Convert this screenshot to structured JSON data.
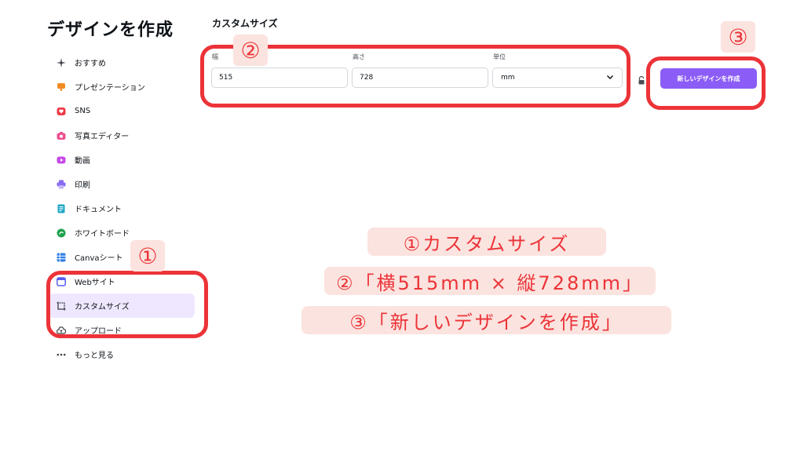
{
  "page_title": "デザインを作成",
  "sidebar": {
    "items": [
      {
        "label": "おすすめ",
        "icon": "sparkle-icon",
        "color": "#3b3f46"
      },
      {
        "label": "プレゼンテーション",
        "icon": "presentation-icon",
        "color": "#f38b23"
      },
      {
        "label": "SNS",
        "icon": "heart-icon",
        "color": "#ef3a48"
      },
      {
        "label": "写真エディター",
        "icon": "camera-icon",
        "color": "#ec4f8f"
      },
      {
        "label": "動画",
        "icon": "video-icon",
        "color": "#c849e8"
      },
      {
        "label": "印刷",
        "icon": "printer-icon",
        "color": "#8a6bf2"
      },
      {
        "label": "ドキュメント",
        "icon": "document-icon",
        "color": "#1ea6c7"
      },
      {
        "label": "ホワイトボード",
        "icon": "whiteboard-icon",
        "color": "#1fa14d"
      },
      {
        "label": "Canvaシート",
        "icon": "spreadsheet-icon",
        "color": "#2f7ee6"
      },
      {
        "label": "Webサイト",
        "icon": "website-icon",
        "color": "#5a5ff0"
      },
      {
        "label": "カスタムサイズ",
        "icon": "custom-size-icon",
        "color": "#3b3f46",
        "active": true
      },
      {
        "label": "アップロード",
        "icon": "upload-cloud-icon",
        "color": "#3b3f46"
      },
      {
        "label": "もっと見る",
        "icon": "more-dots-icon",
        "color": "#3b3f46"
      }
    ]
  },
  "custom_size": {
    "title": "カスタムサイズ",
    "width_label": "幅",
    "width_value": "515",
    "height_label": "高さ",
    "height_value": "728",
    "unit_label": "単位",
    "unit_value": "mm",
    "create_button": "新しいデザインを作成"
  },
  "annotations": {
    "badge_1": "①",
    "badge_2": "②",
    "badge_3": "③",
    "note_lines": [
      "①カスタムサイズ",
      "②「横515mm × 縦728mm」",
      "③「新しいデザインを作成」"
    ],
    "accent_color": "#ec3338",
    "badge_bg": "#fbe3df"
  },
  "colors": {
    "button_bg": "#8b5cf6",
    "active_item_bg": "#efe7ff"
  }
}
